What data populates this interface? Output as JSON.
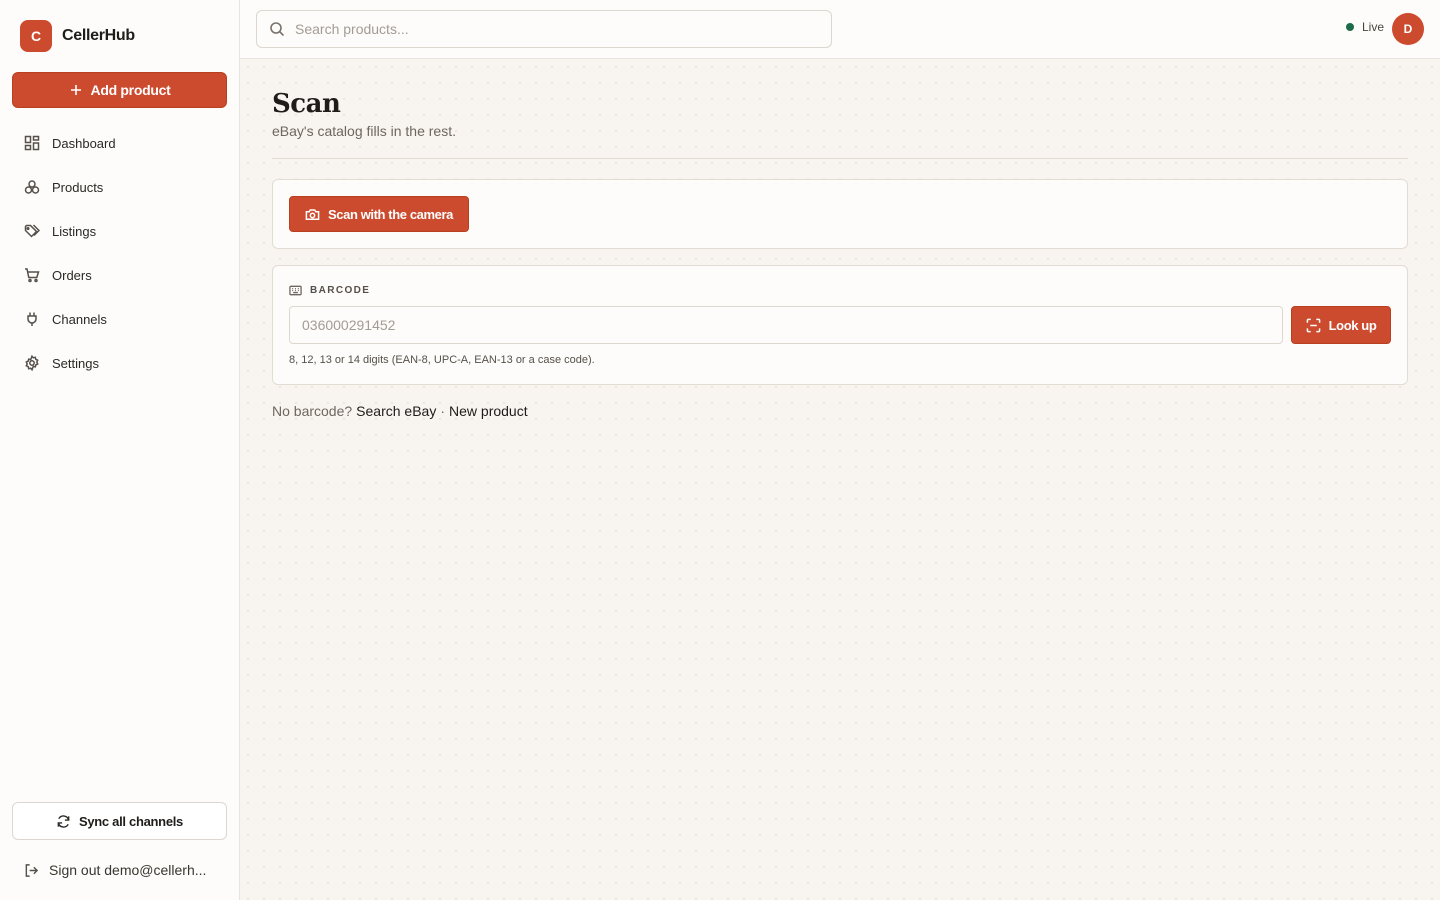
{
  "brand": {
    "logo_letter": "C",
    "name": "CellerHub",
    "accent": "#cc4a2d"
  },
  "sidebar": {
    "add_label": "Add product",
    "items": [
      {
        "label": "Dashboard",
        "icon": "dashboard-icon"
      },
      {
        "label": "Products",
        "icon": "products-icon"
      },
      {
        "label": "Listings",
        "icon": "tag-icon"
      },
      {
        "label": "Orders",
        "icon": "cart-icon"
      },
      {
        "label": "Channels",
        "icon": "plug-icon"
      },
      {
        "label": "Settings",
        "icon": "gear-icon"
      }
    ],
    "sync_label": "Sync all channels",
    "signout_label": "Sign out demo@cellerh..."
  },
  "topbar": {
    "search_placeholder": "Search products...",
    "status_label": "Live",
    "status_color": "#1e6b4a",
    "avatar_letter": "D"
  },
  "page": {
    "title": "Scan",
    "subtitle": "eBay's catalog fills in the rest.",
    "camera_label": "Scan with the camera",
    "barcode": {
      "label": "BARCODE",
      "placeholder": "036000291452",
      "lookup_label": "Look up",
      "hint": "8, 12, 13 or 14 digits (EAN-8, UPC-A, EAN-13 or a case code)."
    },
    "footer": {
      "prefix": "No barcode?",
      "search_link": "Search eBay",
      "separator": "·",
      "new_link": "New product"
    }
  }
}
